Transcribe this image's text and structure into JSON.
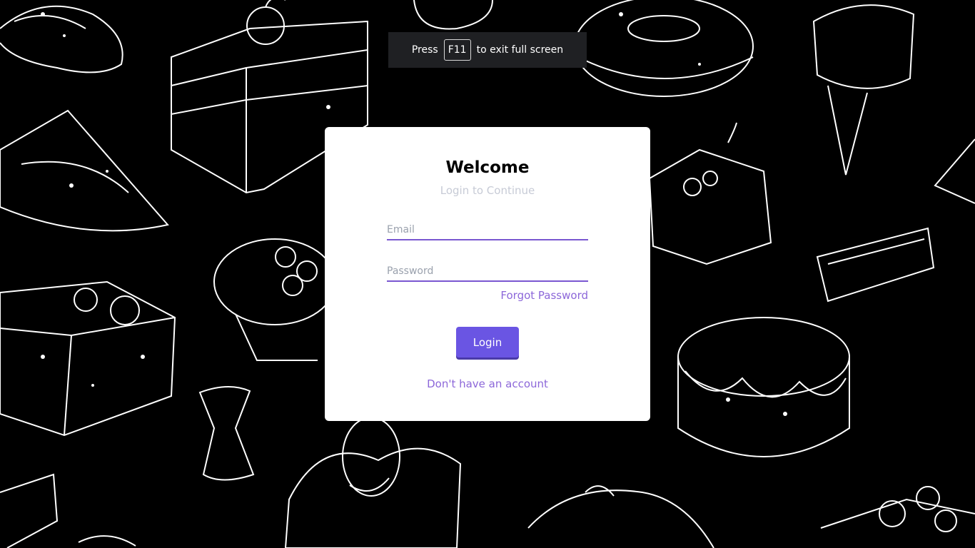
{
  "fullscreen_notice": {
    "prefix": "Press",
    "key": "F11",
    "suffix": "to exit full screen"
  },
  "login_card": {
    "title": "Welcome",
    "subtitle": "Login to Continue",
    "email_placeholder": "Email",
    "password_placeholder": "Password",
    "forgot_password": "Forgot Password",
    "login_button": "Login",
    "signup_link": "Don't have an account"
  },
  "colors": {
    "accent": "#6a55e3",
    "link": "#8c67d9",
    "background": "#000000",
    "card": "#ffffff"
  }
}
